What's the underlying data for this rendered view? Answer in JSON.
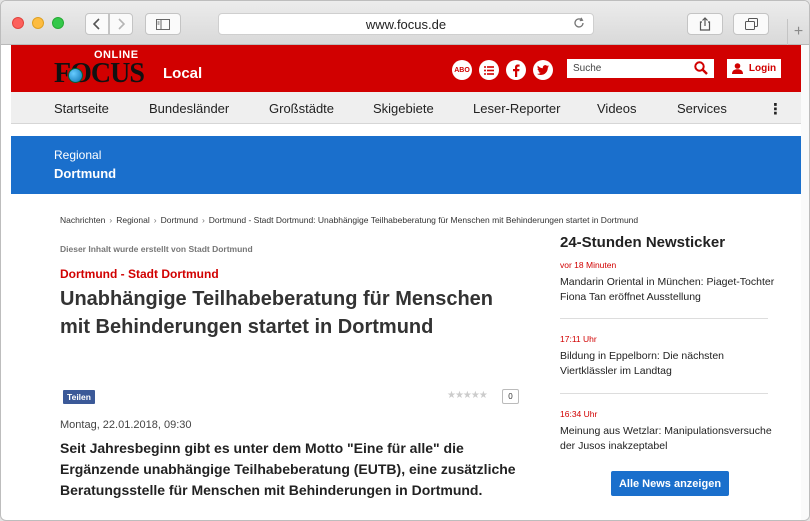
{
  "browser": {
    "url": "www.focus.de",
    "back_icon": "chevron-left-icon",
    "forward_icon": "chevron-right-icon",
    "new_tab_label": "+"
  },
  "header": {
    "logo_online": "ONLINE",
    "logo_focus": "FOCUS",
    "section": "Local",
    "abo_label": "ABO",
    "search_placeholder": "Suche",
    "login_label": "Login",
    "brand_color": "#d10000"
  },
  "nav": {
    "items": [
      "Startseite",
      "Bundesländer",
      "Großstädte",
      "Skigebiete",
      "Leser-Reporter",
      "Videos",
      "Services"
    ],
    "more_icon": "⋮"
  },
  "band": {
    "top": "Regional",
    "city": "Dortmund",
    "color": "#1a6fcc"
  },
  "breadcrumb": {
    "items": [
      "Nachrichten",
      "Regional",
      "Dortmund",
      "Dortmund - Stadt Dortmund: Unabhängige Teilhabeberatung für Menschen mit Behinderungen startet in Dortmund"
    ]
  },
  "article": {
    "byline": "Dieser Inhalt wurde erstellt von Stadt Dortmund",
    "kicker": "Dortmund - Stadt Dortmund",
    "headline": "Unabhängige Teilhabeberatung für Menschen mit Behinderungen startet in Dortmund",
    "share_label": "Teilen",
    "stars": "★★★★★",
    "rating_count": "0",
    "date": "Montag, 22.01.2018, 09:30",
    "lead": "Seit Jahresbeginn gibt es unter dem Motto \"Eine für alle\" die Ergänzende unabhängige Teilhabeberatung (EUTB), eine zusätzliche Beratungsstelle für Menschen mit Behinderungen in Dortmund."
  },
  "ticker": {
    "title": "24-Stunden Newsticker",
    "items": [
      {
        "time": "vor 18 Minuten",
        "text": "Mandarin Oriental in München: Piaget-Tochter Fiona Tan eröffnet Ausstellung"
      },
      {
        "time": "17:11 Uhr",
        "text": "Bildung in Eppelborn: Die nächsten Viertklässler im Landtag"
      },
      {
        "time": "16:34 Uhr",
        "text": "Meinung aus Wetzlar: Manipulationsversuche der Jusos inakzeptabel"
      }
    ],
    "all_news_label": "Alle News anzeigen"
  }
}
